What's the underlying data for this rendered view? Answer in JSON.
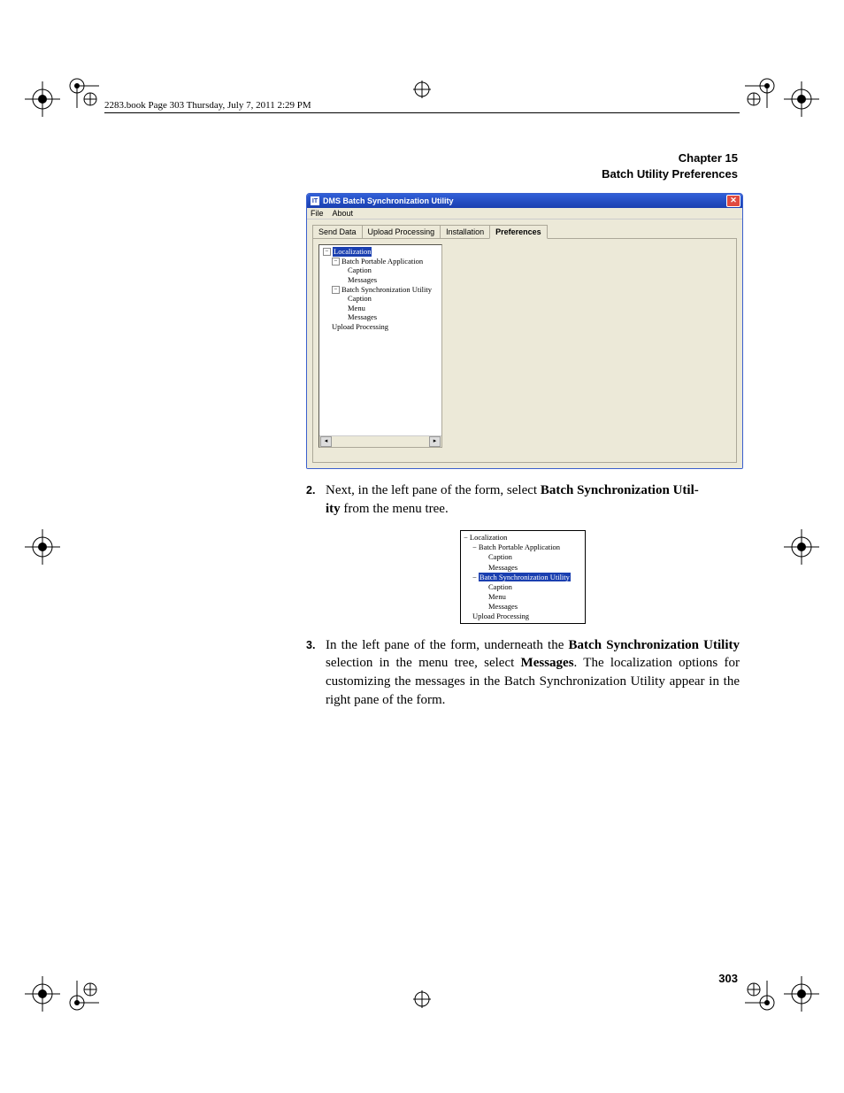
{
  "header_tag": "2283.book  Page 303  Thursday, July 7, 2011  2:29 PM",
  "chapter": {
    "line1": "Chapter 15",
    "line2": "Batch Utility Preferences"
  },
  "app": {
    "title": "DMS Batch Synchronization Utility",
    "menu": {
      "file": "File",
      "about": "About"
    },
    "tabs": {
      "send": "Send Data",
      "upload": "Upload Processing",
      "install": "Installation",
      "prefs": "Preferences"
    },
    "tree": {
      "root": "Localization",
      "bpa": "Batch Portable Application",
      "caption": "Caption",
      "messages": "Messages",
      "bsu": "Batch Synchronization Utility",
      "menu_item": "Menu",
      "upload_node": "Upload Processing"
    }
  },
  "step2": {
    "num": "2.",
    "pre": "Next, in the left pane of the form, select ",
    "bold1a": "Batch Synchronization Util-",
    "bold1b": "ity",
    "post": " from the menu tree."
  },
  "small_tree": {
    "root": "Localization",
    "bpa": "Batch Portable Application",
    "caption": "Caption",
    "messages": "Messages",
    "bsu": "Batch Synchronization Utility",
    "menu_item": "Menu",
    "upload_node": "Upload Processing"
  },
  "step3": {
    "num": "3.",
    "t1": "In the left pane of the form, underneath the ",
    "b1": "Batch Synchronization Utility",
    "t2": " selection in the menu tree, select ",
    "b2": "Messages",
    "t3": ". The localization options for customizing the messages in the Batch Synchronization Utility appear in the right pane of the form."
  },
  "page_number": "303"
}
